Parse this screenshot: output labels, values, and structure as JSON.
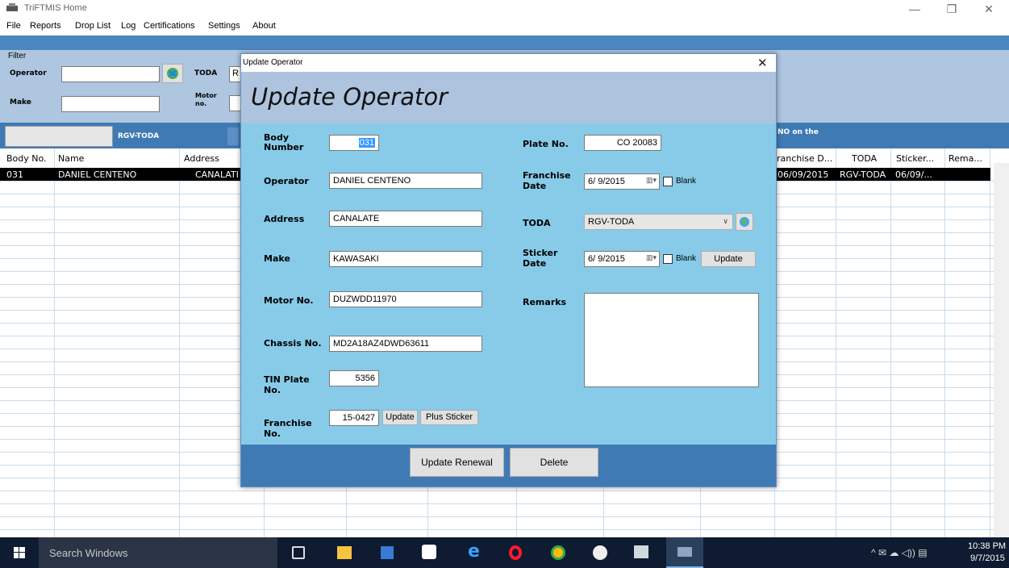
{
  "window": {
    "title": "TriFTMIS Home"
  },
  "menu": [
    "File",
    "Reports",
    "Drop List",
    "Log",
    "Certifications",
    "Settings",
    "About"
  ],
  "filter": {
    "heading": "Filter",
    "operator_label": "Operator",
    "toda_label": "TODA",
    "toda_value": "R",
    "make_label": "Make",
    "motor_label_1": "Motor",
    "motor_label_2": "no."
  },
  "strip": {
    "toda_text": "RGV-TODA",
    "right_text": "NO on the"
  },
  "grid": {
    "headers": {
      "body_no": "Body No.",
      "name": "Name",
      "address": "Address",
      "franchise_date": "ranchise D...",
      "toda": "TODA",
      "sticker": "Sticker...",
      "remarks": "Rema..."
    },
    "row": {
      "body_no": "031",
      "name": "DANIEL CENTENO",
      "address": "CANALATI",
      "franchise_date": "06/09/2015",
      "toda": "RGV-TODA",
      "sticker": "06/09/..."
    }
  },
  "dialog": {
    "window_title": "Update Operator",
    "heading": "Update Operator",
    "labels": {
      "body_number_1": "Body",
      "body_number_2": "Number",
      "operator": "Operator",
      "address": "Address",
      "make": "Make",
      "motor_no": "Motor No.",
      "chassis_no": "Chassis No.",
      "tin_plate_1": "TIN Plate",
      "tin_plate_2": "No.",
      "franchise_no_1": "Franchise",
      "franchise_no_2": "No.",
      "plate_no": "Plate No.",
      "franchise_date_1": "Franchise",
      "franchise_date_2": "Date",
      "toda": "TODA",
      "sticker_date_1": "Sticker",
      "sticker_date_2": "Date",
      "remarks": "Remarks"
    },
    "values": {
      "body_number": "031",
      "operator": "DANIEL CENTENO",
      "address": "CANALATE",
      "make": "KAWASAKI",
      "motor_no": "DUZWDD11970",
      "chassis_no": "MD2A18AZ4DWD63611",
      "tin_plate": "5356",
      "franchise_no": "15-0427",
      "plate_no": "CO 20083",
      "franchise_date": "6/ 9/2015",
      "toda": "RGV-TODA",
      "sticker_date": "6/ 9/2015",
      "remarks": ""
    },
    "buttons": {
      "update": "Update",
      "plus_sticker": "Plus Sticker",
      "sticker_update": "Update",
      "update_renewal": "Update Renewal",
      "delete": "Delete"
    },
    "blank_label": "Blank"
  },
  "taskbar": {
    "search_placeholder": "Search Windows",
    "time": "10:38 PM",
    "date": "9/7/2015"
  },
  "colors": {
    "dialog_body": "#87cbe9",
    "header_band": "#aec3dd",
    "accent_blue": "#3f7ab5",
    "taskbar": "#0e1b30"
  }
}
